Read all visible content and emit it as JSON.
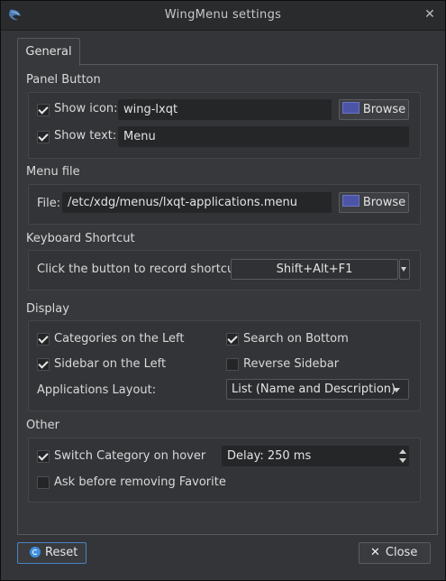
{
  "window": {
    "title": "WingMenu settings",
    "close_glyph": "✕",
    "app_icon": "wing-app-icon"
  },
  "tabs": [
    {
      "label": "General"
    }
  ],
  "panel_button": {
    "title": "Panel Button",
    "show_icon": {
      "label": "Show icon:",
      "checked": true,
      "value": "wing-lxqt"
    },
    "browse_label": "Browse",
    "show_text": {
      "label": "Show text:",
      "checked": true,
      "value": "Menu"
    }
  },
  "menu_file": {
    "title": "Menu file",
    "file_label": "File:",
    "value": "/etc/xdg/menus/lxqt-applications.menu",
    "browse_label": "Browse"
  },
  "shortcut": {
    "title": "Keyboard Shortcut",
    "label": "Click the button to record shortcut:",
    "value": "Shift+Alt+F1"
  },
  "display": {
    "title": "Display",
    "categories_left": {
      "label": "Categories on the Left",
      "checked": true
    },
    "search_bottom": {
      "label": "Search on Bottom",
      "checked": true
    },
    "sidebar_left": {
      "label": "Sidebar on the Left",
      "checked": true
    },
    "reverse_sidebar": {
      "label": "Reverse Sidebar",
      "checked": false
    },
    "layout_label": "Applications Layout:",
    "layout_value": "List (Name and Description)"
  },
  "other": {
    "title": "Other",
    "switch_hover": {
      "label": "Switch Category on hover",
      "checked": true
    },
    "delay_value": "Delay: 250 ms",
    "ask_remove": {
      "label": "Ask before removing Favorite",
      "checked": false
    }
  },
  "footer": {
    "reset_label": "Reset",
    "close_label": "Close"
  },
  "colors": {
    "accent": "#3f8fe0",
    "folder_icon": "#4b54a7",
    "background": "#343538"
  }
}
